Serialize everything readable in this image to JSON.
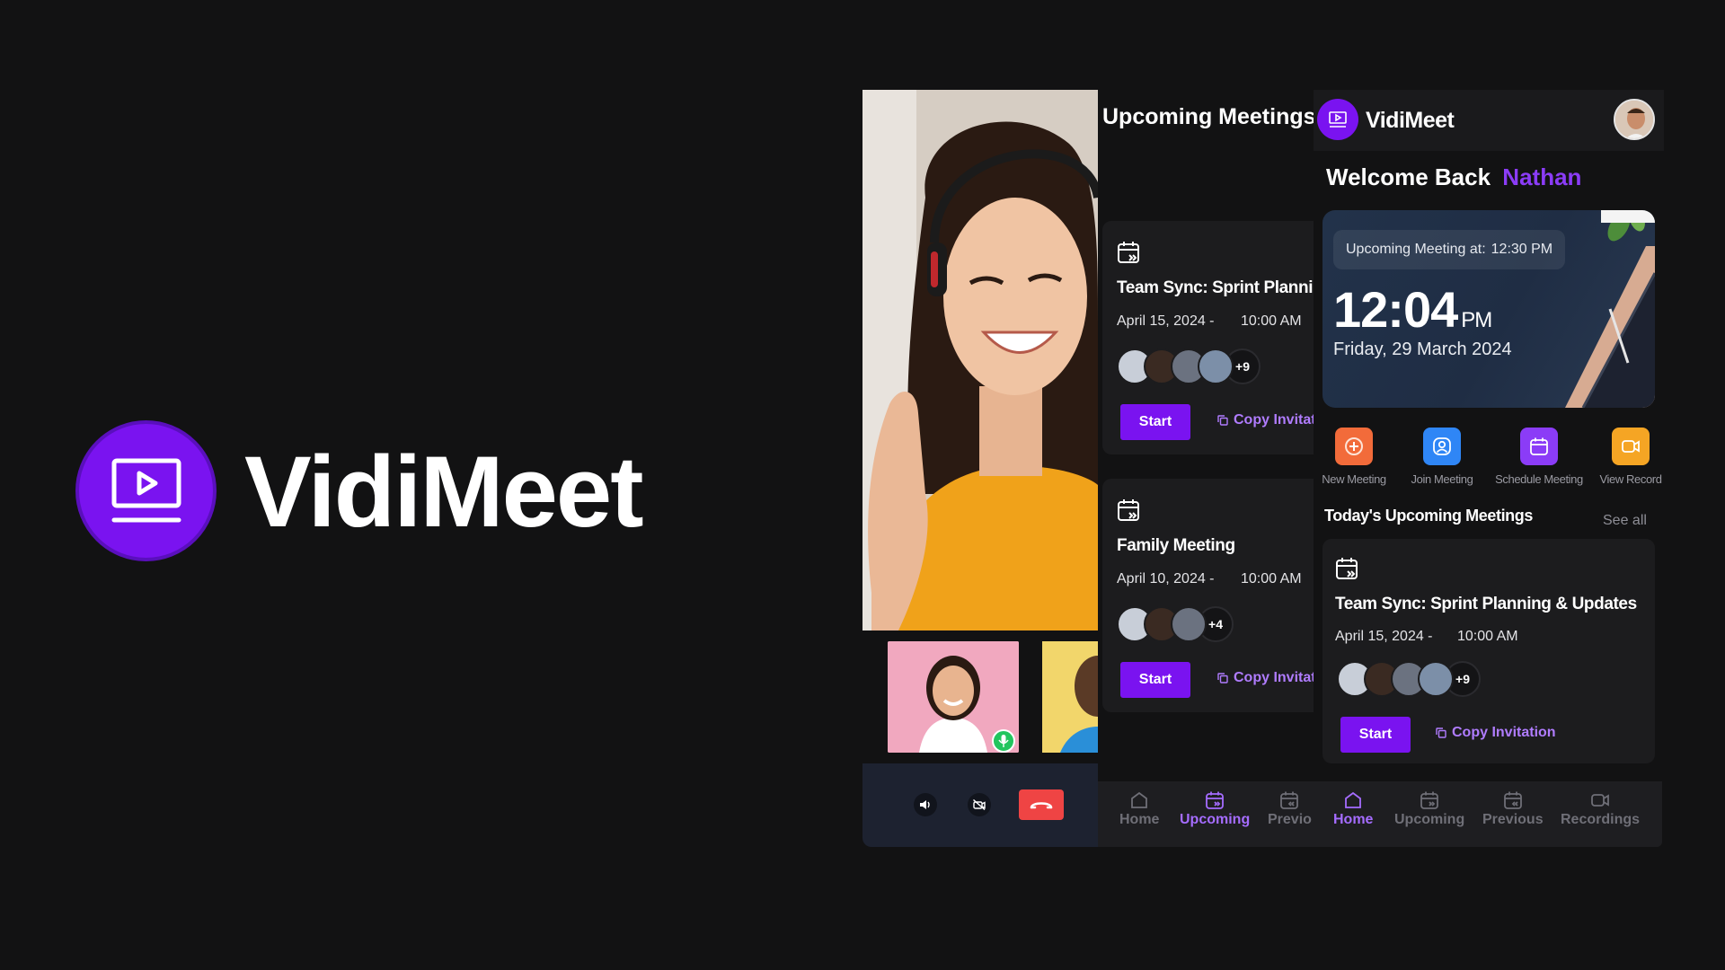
{
  "brand": {
    "name": "VidiMeet",
    "color": "#7a13f0"
  },
  "call": {
    "controls": [
      {
        "icon": "speaker-icon"
      },
      {
        "icon": "camera-switch-icon"
      },
      {
        "icon": "end-call-icon",
        "color": "#ef4444"
      }
    ],
    "mic_status": "on"
  },
  "upcoming": {
    "title": "Upcoming Meetings",
    "cards": [
      {
        "title": "Team Sync: Sprint Planning & Updates",
        "date": "April 15, 2024 -",
        "time": "10:00 AM",
        "extra": "+9",
        "start_label": "Start",
        "copy_label": "Copy Invitation"
      },
      {
        "title": "Family Meeting",
        "date": "April 10, 2024 -",
        "time": "10:00 AM",
        "extra": "+4",
        "start_label": "Start",
        "copy_label": "Copy Invitation"
      }
    ]
  },
  "home": {
    "brand": "VidiMeet",
    "welcome_prefix": "Welcome Back",
    "user_name": "Nathan",
    "user_color": "#8b3cf7",
    "hero": {
      "pill_label": "Upcoming Meeting at:",
      "pill_time": "12:30 PM",
      "clock": "12:04",
      "ampm": "PM",
      "date": "Friday, 29 March 2024"
    },
    "actions": [
      {
        "label": "New Meeting",
        "icon": "plus-icon",
        "color": "#f26b3a"
      },
      {
        "label": "Join Meeting",
        "icon": "user-icon",
        "color": "#2f86f6"
      },
      {
        "label": "Schedule Meeting",
        "icon": "calendar-icon",
        "color": "#8b3cf7"
      },
      {
        "label": "View Record",
        "icon": "video-icon",
        "color": "#f5a524"
      }
    ],
    "section_title": "Today's Upcoming Meetings",
    "see_all": "See all",
    "card": {
      "title": "Team Sync: Sprint Planning & Updates",
      "date": "April 15, 2024 -",
      "time": "10:00 AM",
      "extra": "+9",
      "start_label": "Start",
      "copy_label": "Copy Invitation"
    }
  },
  "nav": {
    "items": [
      {
        "label": "Home",
        "icon": "home-icon",
        "active": false
      },
      {
        "label": "Upcoming",
        "icon": "calendar-icon",
        "active": true
      },
      {
        "label": "Previo",
        "icon": "calendar-icon",
        "active": false
      },
      {
        "label": "Home",
        "icon": "home-icon",
        "active": true
      },
      {
        "label": "Upcoming",
        "icon": "calendar-icon",
        "active": false
      },
      {
        "label": "Previous",
        "icon": "calendar-icon",
        "active": false
      },
      {
        "label": "Recordings",
        "icon": "video-icon",
        "active": false
      }
    ]
  }
}
